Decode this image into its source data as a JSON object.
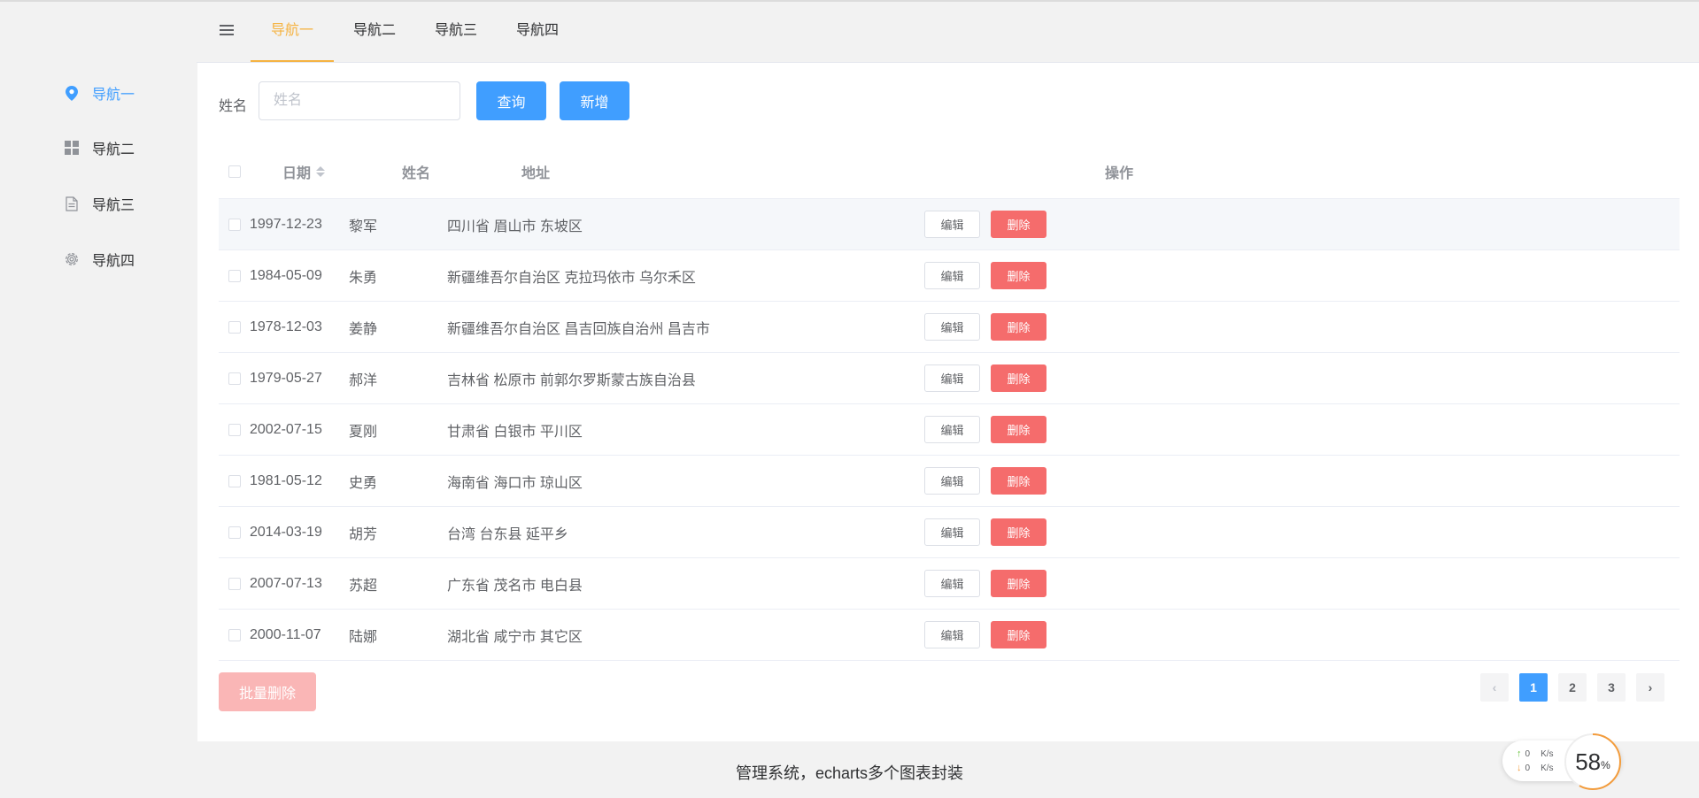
{
  "sidebar": {
    "items": [
      {
        "label": "导航一",
        "icon": "location-icon",
        "active": true
      },
      {
        "label": "导航二",
        "icon": "grid-icon",
        "active": false
      },
      {
        "label": "导航三",
        "icon": "document-icon",
        "active": false
      },
      {
        "label": "导航四",
        "icon": "gear-icon",
        "active": false
      }
    ]
  },
  "topnav": {
    "menu_icon": "hamburger-icon",
    "tabs": [
      {
        "label": "导航一",
        "active": true
      },
      {
        "label": "导航二",
        "active": false
      },
      {
        "label": "导航三",
        "active": false
      },
      {
        "label": "导航四",
        "active": false
      }
    ]
  },
  "search": {
    "label": "姓名",
    "placeholder": "姓名",
    "value": "",
    "query_button": "查询",
    "add_button": "新增"
  },
  "table": {
    "columns": {
      "date": "日期",
      "name": "姓名",
      "address": "地址",
      "actions": "操作"
    },
    "edit_label": "编辑",
    "delete_label": "删除",
    "rows": [
      {
        "date": "1997-12-23",
        "name": "黎军",
        "address": "四川省 眉山市 东坡区"
      },
      {
        "date": "1984-05-09",
        "name": "朱勇",
        "address": "新疆维吾尔自治区 克拉玛依市 乌尔禾区"
      },
      {
        "date": "1978-12-03",
        "name": "姜静",
        "address": "新疆维吾尔自治区 昌吉回族自治州 昌吉市"
      },
      {
        "date": "1979-05-27",
        "name": "郝洋",
        "address": "吉林省 松原市 前郭尔罗斯蒙古族自治县"
      },
      {
        "date": "2002-07-15",
        "name": "夏刚",
        "address": "甘肃省 白银市 平川区"
      },
      {
        "date": "1981-05-12",
        "name": "史勇",
        "address": "海南省 海口市 琼山区"
      },
      {
        "date": "2014-03-19",
        "name": "胡芳",
        "address": "台湾 台东县 延平乡"
      },
      {
        "date": "2007-07-13",
        "name": "苏超",
        "address": "广东省 茂名市 电白县"
      },
      {
        "date": "2000-11-07",
        "name": "陆娜",
        "address": "湖北省 咸宁市 其它区"
      }
    ]
  },
  "batch_delete": "批量删除",
  "pagination": {
    "prev": "‹",
    "next": "›",
    "pages": [
      "1",
      "2",
      "3"
    ],
    "current": "1"
  },
  "footer": {
    "text": "管理系统，echarts多个图表封装"
  },
  "speed_widget": {
    "upload": "0",
    "download": "0",
    "unit": "K/s",
    "percent_value": "58",
    "percent_sign": "%",
    "percent": 58
  },
  "colors": {
    "primary": "#409eff",
    "danger": "#f56c6c",
    "danger_disabled": "#fab6b6",
    "active_tab": "#f5b342",
    "gauge": "#f39c3c"
  }
}
